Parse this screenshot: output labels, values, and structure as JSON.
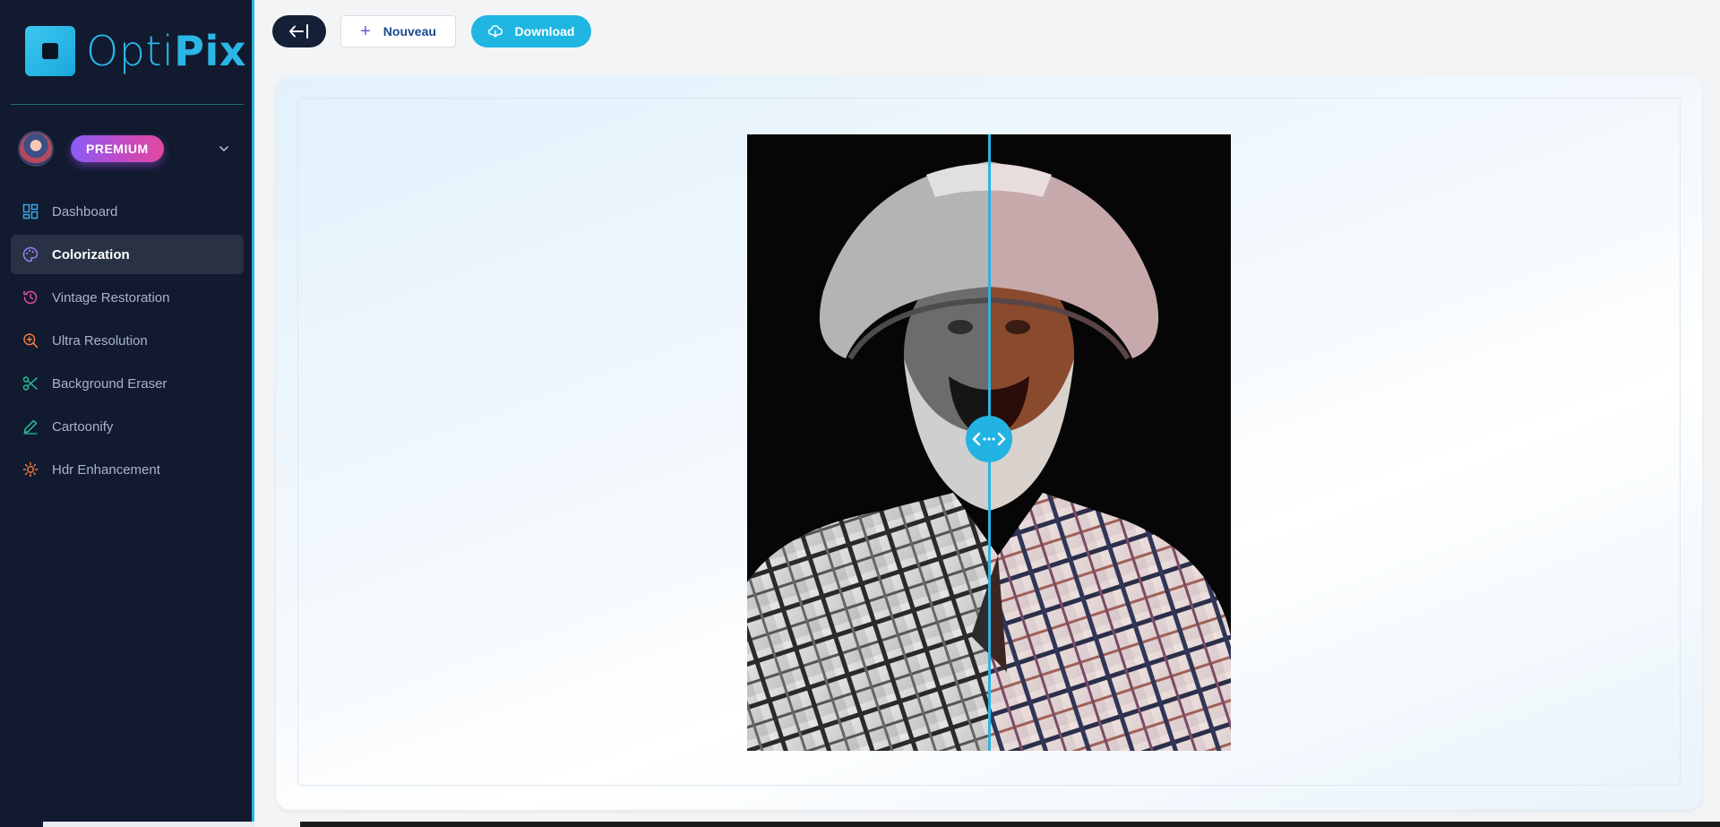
{
  "app": {
    "logo_light": "Opti",
    "logo_bold": "Pix"
  },
  "user": {
    "plan_badge": "PREMIUM"
  },
  "sidebar": {
    "items": [
      {
        "label": "Dashboard",
        "icon": "dashboard-grid-icon",
        "color": "#3ba7e6",
        "active": false
      },
      {
        "label": "Colorization",
        "icon": "palette-icon",
        "color": "#9b7cf0",
        "active": true
      },
      {
        "label": "Vintage Restoration",
        "icon": "history-icon",
        "color": "#e0509a",
        "active": false
      },
      {
        "label": "Ultra Resolution",
        "icon": "zoom-in-icon",
        "color": "#f07a3c",
        "active": false
      },
      {
        "label": "Background Eraser",
        "icon": "scissors-icon",
        "color": "#27c49a",
        "active": false
      },
      {
        "label": "Cartoonify",
        "icon": "pen-icon",
        "color": "#27c49a",
        "active": false
      },
      {
        "label": "Hdr Enhancement",
        "icon": "sun-icon",
        "color": "#f07a3c",
        "active": false
      }
    ]
  },
  "toolbar": {
    "new_label": "Nouveau",
    "download_label": "Download"
  },
  "colors": {
    "accent": "#23b3e3",
    "sidebar_bg": "#111a2e",
    "premium_gradient_start": "#8b5cf6",
    "premium_gradient_end": "#e2489f"
  },
  "comparison": {
    "split_fraction": 0.5
  }
}
